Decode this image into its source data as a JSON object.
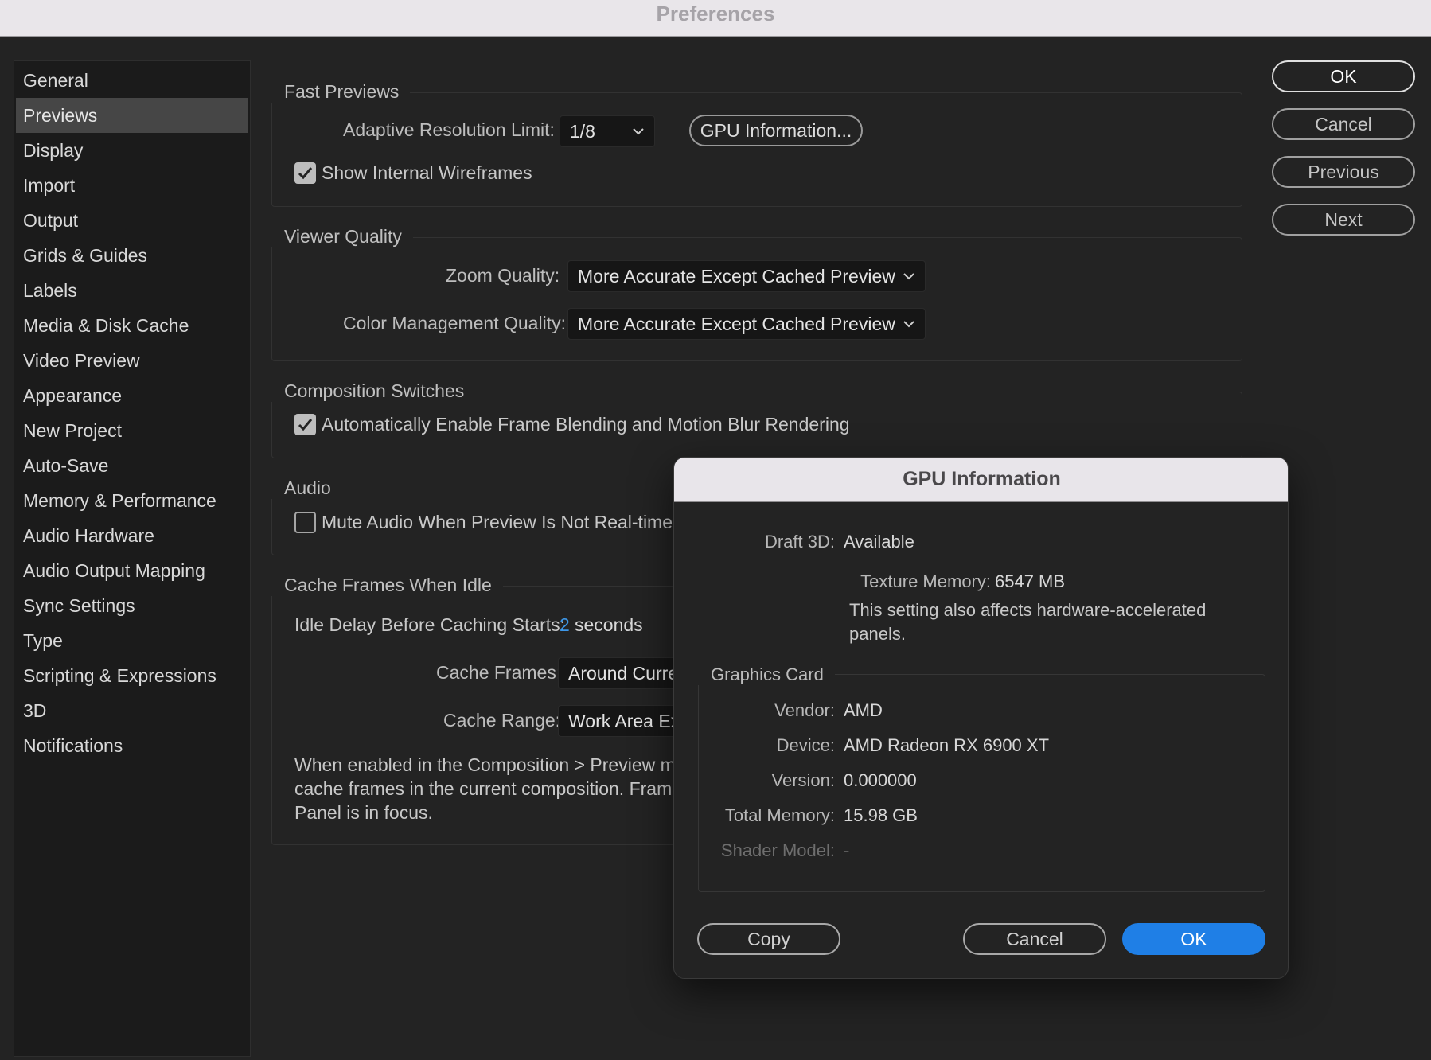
{
  "window": {
    "title": "Preferences"
  },
  "sidebar": {
    "items": [
      {
        "label": "General"
      },
      {
        "label": "Previews"
      },
      {
        "label": "Display"
      },
      {
        "label": "Import"
      },
      {
        "label": "Output"
      },
      {
        "label": "Grids & Guides"
      },
      {
        "label": "Labels"
      },
      {
        "label": "Media & Disk Cache"
      },
      {
        "label": "Video Preview"
      },
      {
        "label": "Appearance"
      },
      {
        "label": "New Project"
      },
      {
        "label": "Auto-Save"
      },
      {
        "label": "Memory & Performance"
      },
      {
        "label": "Audio Hardware"
      },
      {
        "label": "Audio Output Mapping"
      },
      {
        "label": "Sync Settings"
      },
      {
        "label": "Type"
      },
      {
        "label": "Scripting & Expressions"
      },
      {
        "label": "3D"
      },
      {
        "label": "Notifications"
      }
    ],
    "selected": "Previews"
  },
  "fast_previews": {
    "title": "Fast Previews",
    "adaptive_label": "Adaptive Resolution Limit:",
    "adaptive_value": "1/8",
    "gpu_button": "GPU Information...",
    "wireframes_label": "Show Internal Wireframes",
    "wireframes_checked": true
  },
  "viewer_quality": {
    "title": "Viewer Quality",
    "zoom_label": "Zoom Quality:",
    "zoom_value": "More Accurate Except Cached Preview",
    "color_label": "Color Management Quality:",
    "color_value": "More Accurate Except Cached Preview"
  },
  "composition_switches": {
    "title": "Composition Switches",
    "auto_label": "Automatically Enable Frame Blending and Motion Blur Rendering",
    "auto_checked": true
  },
  "audio": {
    "title": "Audio",
    "mute_label": "Mute Audio When Preview Is Not Real-time",
    "mute_checked": false
  },
  "cache_idle": {
    "title": "Cache Frames When Idle",
    "delay_label": "Idle Delay Before Caching Starts:",
    "delay_value": "2",
    "delay_unit": "seconds",
    "frames_label": "Cache Frames:",
    "frames_value": "Around Curre",
    "range_label": "Cache Range:",
    "range_value": "Work Area Ex",
    "desc_line1": "When enabled in the Composition > Preview me",
    "desc_line2": "cache frames in the current composition. Frames",
    "desc_line3": "Panel is in focus."
  },
  "dialog_buttons": {
    "ok": "OK",
    "cancel": "Cancel",
    "previous": "Previous",
    "next": "Next"
  },
  "gpu_modal": {
    "title": "GPU Information",
    "draft_label": "Draft 3D:",
    "draft_value": "Available",
    "texture_label": "Texture Memory:",
    "texture_value": "6547",
    "texture_unit": "MB",
    "note_line1": "This setting also affects hardware-accelerated",
    "note_line2": "panels.",
    "graphics_title": "Graphics Card",
    "vendor_label": "Vendor:",
    "vendor_value": "AMD",
    "device_label": "Device:",
    "device_value": "AMD Radeon RX 6900 XT",
    "version_label": "Version:",
    "version_value": "0.000000",
    "memory_label": "Total Memory:",
    "memory_value": "15.98 GB",
    "shader_label": "Shader Model:",
    "shader_value": "-",
    "copy_button": "Copy",
    "cancel_button": "Cancel",
    "ok_button": "OK"
  },
  "colors": {
    "accent": "#1f7fe6",
    "link_value": "#3d97e8",
    "background": "#232323"
  }
}
